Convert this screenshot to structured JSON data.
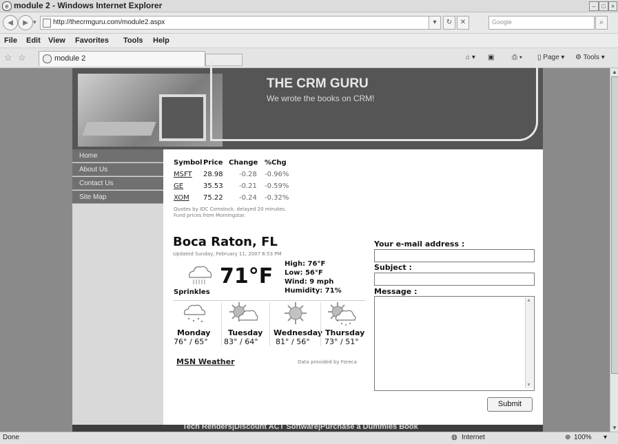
{
  "window": {
    "title": "module 2 - Windows Internet Explorer",
    "url": "http://thecrmguru.com/module2.aspx",
    "search_placeholder": "Google",
    "menu": [
      "File",
      "Edit",
      "View",
      "Favorites",
      "Tools",
      "Help"
    ],
    "tab_title": "module 2",
    "tools": {
      "page": "Page",
      "tools": "Tools"
    },
    "status": {
      "left": "Done",
      "zone": "Internet",
      "zoom": "100%"
    }
  },
  "header": {
    "title": "THE CRM GURU",
    "subtitle": "We wrote the books on CRM!"
  },
  "nav": [
    "Home",
    "About Us",
    "Contact Us",
    "Site Map"
  ],
  "stocks": {
    "headers": [
      "Symbol",
      "Price",
      "Change",
      "%Chg"
    ],
    "rows": [
      {
        "symbol": "MSFT",
        "price": "28.98",
        "change": "-0.28",
        "pct": "-0.96%"
      },
      {
        "symbol": "GE",
        "price": "35.53",
        "change": "-0.21",
        "pct": "-0.59%"
      },
      {
        "symbol": "XOM",
        "price": "75.22",
        "change": "-0.24",
        "pct": "-0.32%"
      }
    ],
    "note1": "Quotes by IDC Comstock. delayed 20 minutes.",
    "note2": "Fund prices from Morningstar."
  },
  "weather": {
    "city": "Boca Raton, FL",
    "updated": "Updated Sunday, February 11, 2007 6:53 PM",
    "current_temp": "71°F",
    "condition": "Sprinkles",
    "high": "High: 76°F",
    "low": "Low: 56°F",
    "wind": "Wind: 9 mph",
    "humidity": "Humidity: 71%",
    "forecast": [
      {
        "day": "Monday",
        "temps": "76° / 65°",
        "icon": "rain-cloud"
      },
      {
        "day": "Tuesday",
        "temps": "83° / 64°",
        "icon": "sun-cloud"
      },
      {
        "day": "Wednesday",
        "temps": "81° / 56°",
        "icon": "sun"
      },
      {
        "day": "Thursday",
        "temps": "73° / 51°",
        "icon": "sun-rain-cloud"
      }
    ],
    "link": "MSN Weather",
    "provider": "Data provided by Foreca"
  },
  "form": {
    "email_label": "Your e-mail address :",
    "subject_label": "Subject :",
    "message_label": "Message :",
    "submit": "Submit"
  },
  "footer": "Tech Renders|Discount ACT Software|Purchase a Dummies Book"
}
